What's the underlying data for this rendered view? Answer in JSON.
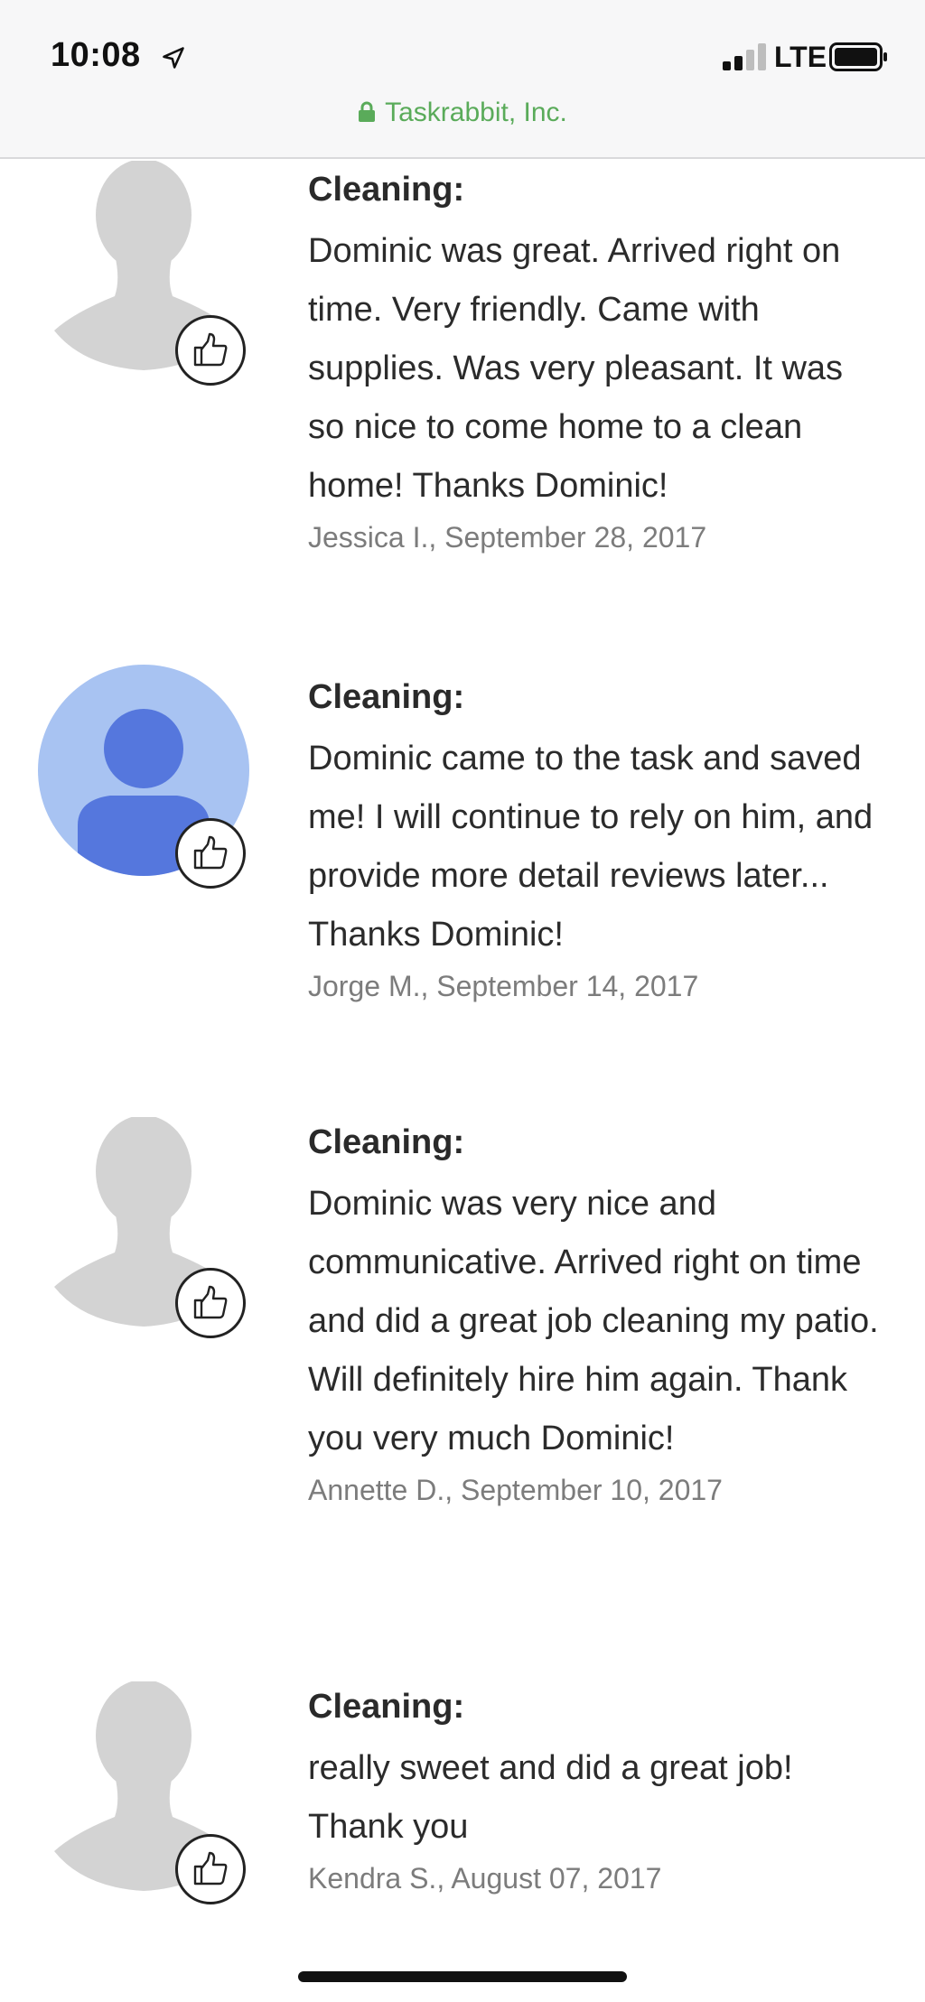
{
  "status_bar": {
    "time": "10:08",
    "network": "LTE",
    "location_icon": "location-arrow-icon",
    "signal_icon": "signal-icon",
    "battery_icon": "battery-icon"
  },
  "browser": {
    "site_name": "Taskrabbit, Inc.",
    "lock_icon": "lock-icon",
    "accent_color": "#5aab5a"
  },
  "reviews": [
    {
      "avatar": "default-silhouette",
      "category": "Cleaning:",
      "text": "Dominic was great. Arrived right on time. Very friendly. Came with supplies. Was very pleasant. It was so nice to come home to a clean home! Thanks Dominic!",
      "author": "Jessica I., September 28, 2017"
    },
    {
      "avatar": "blue-circle-avatar",
      "category": "Cleaning:",
      "text": "Dominic came to the task and saved me! I will continue to rely on him, and provide more detail reviews later... Thanks Dominic!",
      "author": "Jorge M., September 14, 2017"
    },
    {
      "avatar": "default-silhouette",
      "category": "Cleaning:",
      "text": "Dominic was very nice and communicative. Arrived right on time and did a great job cleaning my patio. Will definitely hire him again. Thank you very much Dominic!",
      "author": "Annette D., September 10, 2017"
    },
    {
      "avatar": "default-silhouette",
      "category": "Cleaning:",
      "text": "really sweet and did a great job! Thank you",
      "author": "Kendra S., August 07, 2017"
    }
  ]
}
